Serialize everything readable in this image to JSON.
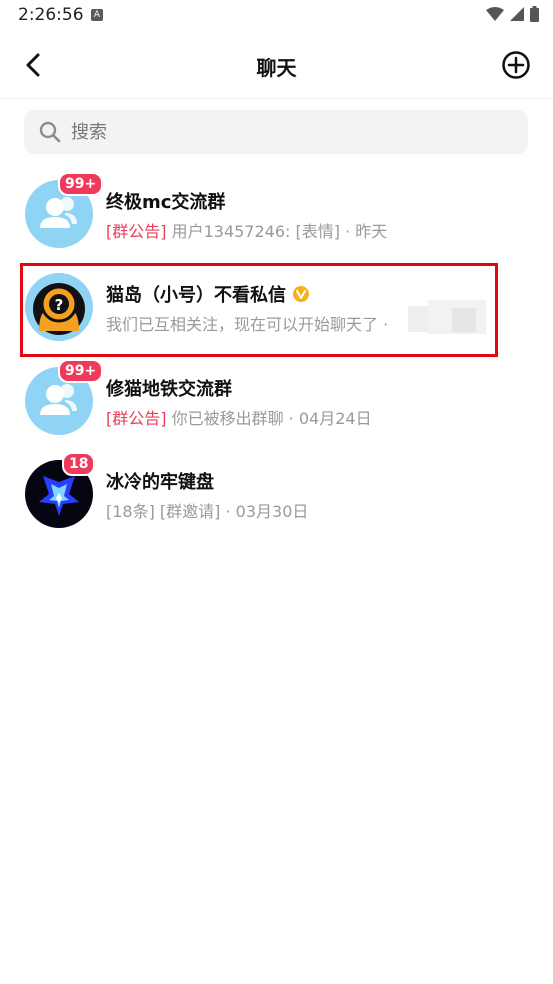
{
  "status": {
    "time": "2:26:56",
    "a_icon": "A"
  },
  "nav": {
    "title": "聊天",
    "back_icon": "chevron-left-icon",
    "add_icon": "plus-circle-icon"
  },
  "search": {
    "placeholder": "搜索"
  },
  "chats": [
    {
      "name": "终极mc交流群",
      "badge": "99+",
      "tag": "[群公告]",
      "preview": " 用户13457246: [表情] · 昨天",
      "avatar": "group-avatar"
    },
    {
      "name": "猫岛（小号）不看私信",
      "verified": true,
      "preview": "我们已互相关注，现在可以开始聊天了 · ",
      "avatar": "cat-island-avatar"
    },
    {
      "name": "修猫地铁交流群",
      "badge": "99+",
      "tag": "[群公告]",
      "preview": " 你已被移出群聊 · 04月24日",
      "avatar": "group-avatar"
    },
    {
      "name": "冰冷的牢键盘",
      "badge": "18",
      "preview": "[18条] [群邀请] · 03月30日",
      "avatar": "ice-avatar"
    }
  ],
  "colors": {
    "accent_red": "#e8405a",
    "badge": "#ef3b5b",
    "avatar_blue": "#8fd3f5",
    "highlight_frame": "#e30613"
  }
}
